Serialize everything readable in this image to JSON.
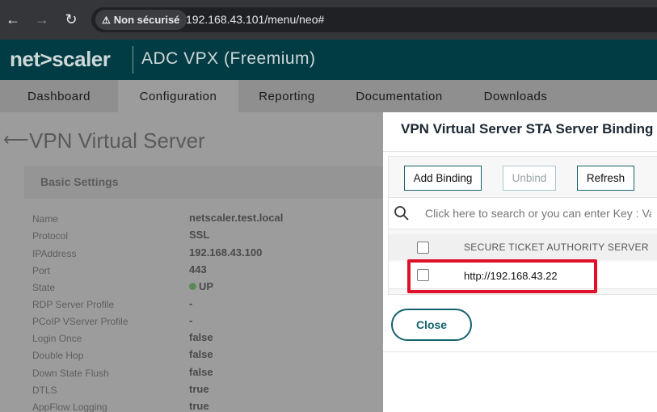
{
  "browser": {
    "security_label": "Non sécurisé",
    "url": "192.168.43.101/menu/neo#"
  },
  "header": {
    "brand": "net>scaler",
    "product": "ADC VPX (Freemium)"
  },
  "tabs": [
    {
      "label": "Dashboard"
    },
    {
      "label": "Configuration"
    },
    {
      "label": "Reporting"
    },
    {
      "label": "Documentation"
    },
    {
      "label": "Downloads"
    }
  ],
  "page": {
    "title": "VPN Virtual Server",
    "settings_title": "Basic Settings",
    "fields": [
      {
        "label": "Name",
        "value": "netscaler.test.local"
      },
      {
        "label": "Protocol",
        "value": "SSL"
      },
      {
        "label": "IPAddress",
        "value": "192.168.43.100"
      },
      {
        "label": "Port",
        "value": "443"
      },
      {
        "label": "State",
        "value": "UP"
      },
      {
        "label": "RDP Server Profile",
        "value": "-"
      },
      {
        "label": "PCoIP VServer Profile",
        "value": "-"
      },
      {
        "label": "Login Once",
        "value": "false"
      },
      {
        "label": "Double Hop",
        "value": "false"
      },
      {
        "label": "Down State Flush",
        "value": "false"
      },
      {
        "label": "DTLS",
        "value": "true"
      },
      {
        "label": "AppFlow Logging",
        "value": "true"
      }
    ]
  },
  "panel": {
    "title": "VPN Virtual Server STA Server Binding",
    "buttons": {
      "add": "Add Binding",
      "unbind": "Unbind",
      "refresh": "Refresh"
    },
    "search_placeholder": "Click here to search or you can enter Key : Value format",
    "column_header": "SECURE TICKET AUTHORITY SERVER",
    "rows": [
      {
        "server": "http://192.168.43.22"
      }
    ],
    "close_label": "Close"
  },
  "colors": {
    "header_bg": "#013b43",
    "accent": "#14626c",
    "highlight": "#e0102a"
  }
}
